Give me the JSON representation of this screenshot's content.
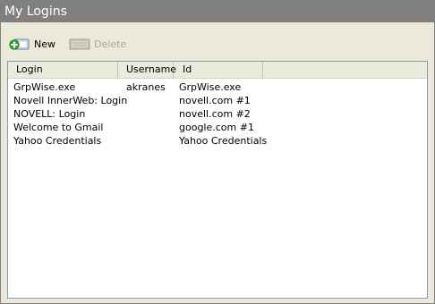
{
  "panel": {
    "title": "My Logins"
  },
  "toolbar": {
    "new_label": "New",
    "delete_label": "Delete"
  },
  "table": {
    "columns": [
      "Login",
      "Username",
      "Id"
    ],
    "rows": [
      [
        "GrpWise.exe",
        "akranes",
        "GrpWise.exe"
      ],
      [
        "Novell InnerWeb: Login",
        "",
        "novell.com #1"
      ],
      [
        "NOVELL: Login",
        "",
        "novell.com #2"
      ],
      [
        "Welcome to Gmail",
        "",
        "google.com #1"
      ],
      [
        "Yahoo Credentials",
        "",
        "Yahoo Credentials"
      ]
    ]
  },
  "icons": {
    "new": "add-plus-icon",
    "delete": "delete-disabled-icon"
  },
  "colors": {
    "titlebar": "#808080",
    "background": "#ece9d8",
    "list_border": "#7f9db9",
    "disabled_text": "#aca899"
  }
}
